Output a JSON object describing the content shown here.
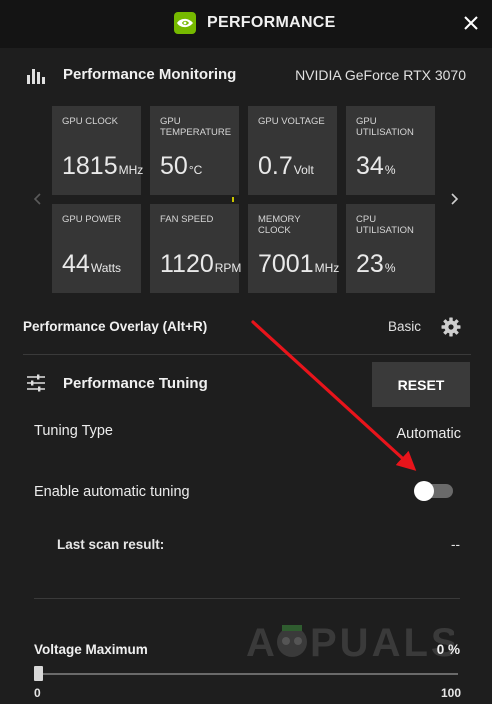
{
  "window": {
    "title": "PERFORMANCE",
    "logo_icon": "nvidia-logo-icon",
    "accent_color": "#76b900"
  },
  "monitoring": {
    "title": "Performance Monitoring",
    "gpu_name": "NVIDIA GeForce RTX 3070",
    "tiles": [
      {
        "label": "GPU CLOCK",
        "value": "1815",
        "unit": "MHz"
      },
      {
        "label": "GPU TEMPERATURE",
        "value": "50",
        "unit": "°C"
      },
      {
        "label": "GPU VOLTAGE",
        "value": "0.7",
        "unit": "Volt"
      },
      {
        "label": "GPU UTILISATION",
        "value": "34",
        "unit": "%"
      },
      {
        "label": "GPU POWER",
        "value": "44",
        "unit": "Watts"
      },
      {
        "label": "FAN SPEED",
        "value": "1120",
        "unit": "RPM"
      },
      {
        "label": "MEMORY CLOCK",
        "value": "7001",
        "unit": "MHz"
      },
      {
        "label": "CPU UTILISATION",
        "value": "23",
        "unit": "%"
      }
    ]
  },
  "overlay": {
    "label": "Performance Overlay (Alt+R)",
    "mode": "Basic"
  },
  "tuning": {
    "title": "Performance Tuning",
    "reset_label": "RESET",
    "type_label": "Tuning Type",
    "type_value": "Automatic",
    "auto_label": "Enable automatic tuning",
    "auto_enabled": false,
    "scan_label": "Last scan result:",
    "scan_value": "--",
    "voltage_label": "Voltage Maximum",
    "voltage_value": "0 %",
    "voltage_percent": 0,
    "slider_min": "0",
    "slider_max": "100"
  },
  "annotation": {
    "arrow_color": "#e8141b"
  },
  "watermark": {
    "text": "APPUALS"
  }
}
